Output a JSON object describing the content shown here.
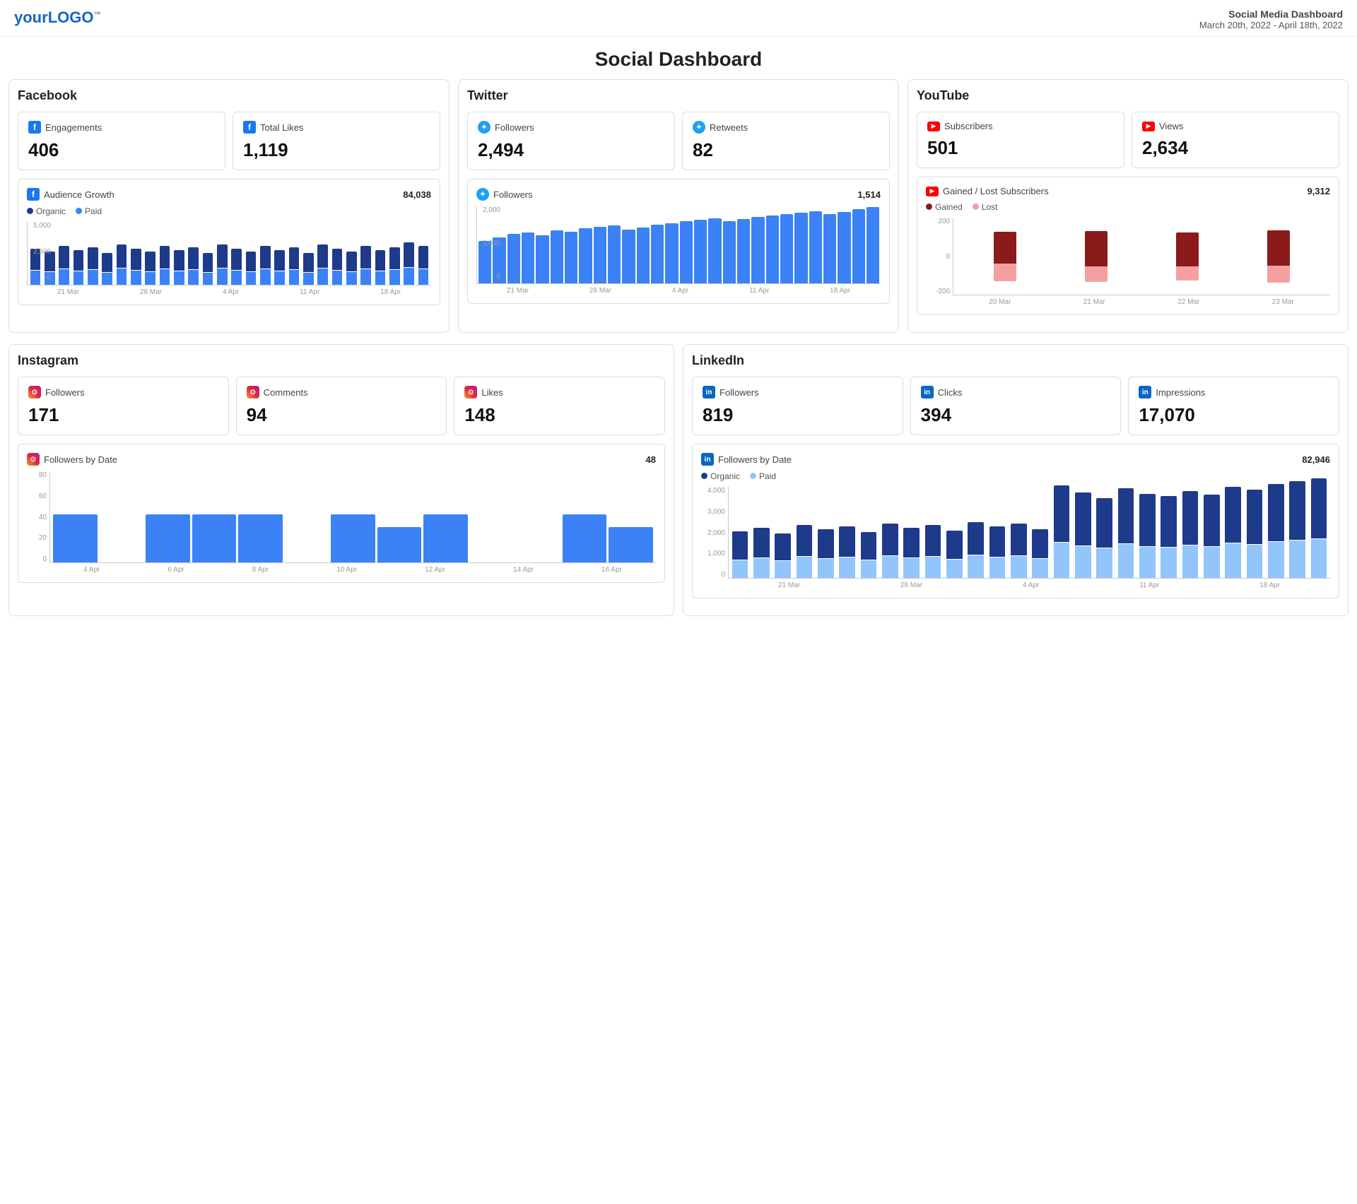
{
  "header": {
    "logo_text": "your",
    "logo_brand": "LOGO",
    "logo_tm": "™",
    "dashboard_title": "Social Media Dashboard",
    "date_range": "March 20th, 2022 - April 18th, 2022"
  },
  "page": {
    "title": "Social Dashboard"
  },
  "facebook": {
    "section_title": "Facebook",
    "engagements_label": "Engagements",
    "engagements_value": "406",
    "total_likes_label": "Total Likes",
    "total_likes_value": "1,119",
    "chart_title": "Audience Growth",
    "chart_total": "84,038",
    "legend_organic": "Organic",
    "legend_paid": "Paid",
    "y_labels": [
      "5,000",
      "2,500",
      "0"
    ],
    "x_labels": [
      "21 Mar",
      "28 Mar",
      "4 Apr",
      "11 Apr",
      "18 Apr"
    ]
  },
  "twitter": {
    "section_title": "Twitter",
    "followers_label": "Followers",
    "followers_value": "2,494",
    "retweets_label": "Retweets",
    "retweets_value": "82",
    "chart_title": "Followers",
    "chart_total": "1,514",
    "y_labels": [
      "2,000",
      "1,000",
      "0"
    ],
    "x_labels": [
      "21 Mar",
      "28 Mar",
      "4 Apr",
      "11 Apr",
      "18 Apr"
    ]
  },
  "youtube": {
    "section_title": "YouTube",
    "subscribers_label": "Subscribers",
    "subscribers_value": "501",
    "views_label": "Views",
    "views_value": "2,634",
    "chart_title": "Gained / Lost Subscribers",
    "chart_total": "9,312",
    "legend_gained": "Gained",
    "legend_lost": "Lost",
    "y_labels": [
      "200",
      "0",
      "-200"
    ],
    "x_labels": [
      "20 Mar",
      "21 Mar",
      "22 Mar",
      "23 Mar"
    ]
  },
  "instagram": {
    "section_title": "Instagram",
    "followers_label": "Followers",
    "followers_value": "171",
    "comments_label": "Comments",
    "comments_value": "94",
    "likes_label": "Likes",
    "likes_value": "148",
    "chart_title": "Followers by Date",
    "chart_total": "48",
    "y_labels": [
      "80",
      "60",
      "40",
      "20",
      "0"
    ],
    "x_labels": [
      "4 Apr",
      "6 Apr",
      "8 Apr",
      "10 Apr",
      "12 Apr",
      "14 Apr",
      "16 Apr"
    ]
  },
  "linkedin": {
    "section_title": "LinkedIn",
    "followers_label": "Followers",
    "followers_value": "819",
    "clicks_label": "Clicks",
    "clicks_value": "394",
    "impressions_label": "Impressions",
    "impressions_value": "17,070",
    "chart_title": "Followers by Date",
    "chart_total": "82,946",
    "legend_organic": "Organic",
    "legend_paid": "Paid",
    "y_labels": [
      "4,000",
      "3,000",
      "2,000",
      "1,000",
      "0"
    ],
    "x_labels": [
      "21 Mar",
      "28 Mar",
      "4 Apr",
      "11 Apr",
      "18 Apr"
    ]
  }
}
